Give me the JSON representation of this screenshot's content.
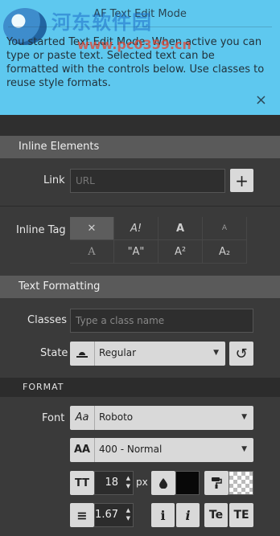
{
  "banner": {
    "title": "AF Text Edit Mode",
    "description": "You started Text Edit Mode. When active you can type or paste text. Selected text can be formatted with the controls below. Use classes to reuse style formats.",
    "watermark_cn": "河东软件园",
    "watermark_url": "www.pc0359.cn",
    "close_icon": "×"
  },
  "inline_elements": {
    "header": "Inline Elements",
    "link_label": "Link",
    "link_placeholder": "URL",
    "add_icon": "+",
    "inline_tag_label": "Inline Tag",
    "tags": [
      "✕",
      "A!",
      "A",
      "A",
      "A",
      "\"A\"",
      "A²",
      "A₂"
    ]
  },
  "text_formatting": {
    "header": "Text Formatting",
    "classes_label": "Classes",
    "classes_placeholder": "Type a class name",
    "state_label": "State",
    "state_value": "Regular",
    "reset_icon": "↺"
  },
  "format": {
    "header": "FORMAT",
    "font_label": "Font",
    "font_icon": "Aa",
    "font_value": "Roboto",
    "weight_icon": "AA",
    "weight_value": "400 - Normal",
    "size_icon": "TT",
    "size_value": "18",
    "size_unit": "px",
    "color_icon": "drop-icon",
    "bg_icon": "paint-roller-icon",
    "line_height_icon": "≡",
    "line_height_value": "1.67",
    "italic_labels": [
      "i",
      "i"
    ],
    "case_labels": [
      "Te",
      "TE"
    ],
    "text_color": "#080808"
  }
}
